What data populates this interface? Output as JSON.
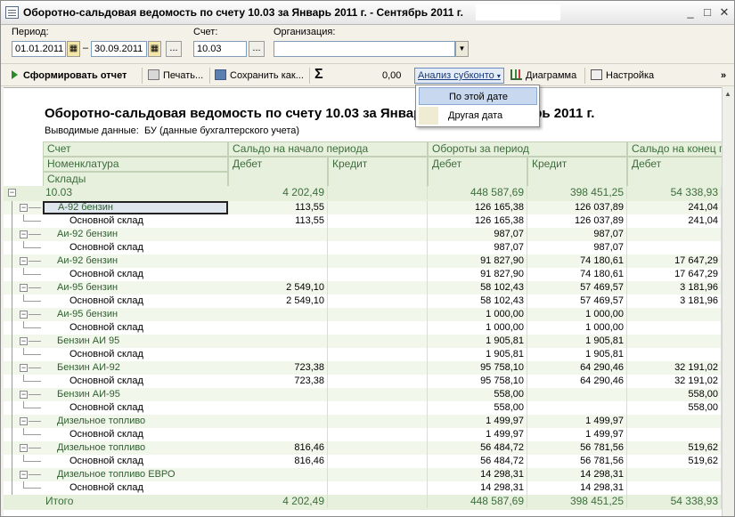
{
  "window": {
    "title": "Оборотно-сальдовая ведомость по счету 10.03 за Январь 2011 г. - Сентябрь 2011 г.",
    "btn_min": "_",
    "btn_max": "□",
    "btn_close": "✕"
  },
  "params": {
    "period_label": "Период:",
    "date_from": "01.01.2011",
    "dash": "–",
    "date_to": "30.09.2011",
    "account_label": "Счет:",
    "account": "10.03",
    "org_label": "Организация:",
    "org_value": "",
    "dots": "..."
  },
  "toolbar": {
    "generate": "Сформировать отчет",
    "print": "Печать...",
    "save": "Сохранить как...",
    "sigma": "Σ",
    "sum_value": "0,00",
    "analysis": "Анализ субконто",
    "diagram": "Диаграмма",
    "settings": "Настройка",
    "more": "»"
  },
  "dropdown": {
    "items": [
      "По этой дате",
      "Другая дата"
    ]
  },
  "report": {
    "title": "Оборотно-сальдовая ведомость по счету 10.03 за Январь 2011 г. - Сентябрь 2011 г.",
    "subtitle_label": "Выводимые данные:",
    "subtitle_value": "БУ (данные бухгалтерского учета)",
    "headers": {
      "account": "Счет",
      "nomenclature": "Номенклатура",
      "warehouses": "Склады",
      "opening": "Сальдо на начало периода",
      "turnover": "Обороты за период",
      "closing": "Сальдо на конец периода",
      "debit": "Дебет",
      "credit": "Кредит"
    },
    "total_row": {
      "name": "10.03",
      "open_d": "4 202,49",
      "turn_d": "448 587,69",
      "turn_c": "398 451,25",
      "close_d": "54 338,93"
    },
    "rows": [
      {
        "name": "А-92 бензин",
        "level": 1,
        "open_d": "113,55",
        "turn_d": "126 165,38",
        "turn_c": "126 037,89",
        "close_d": "241,04"
      },
      {
        "name": "Основной склад",
        "level": 2,
        "open_d": "113,55",
        "turn_d": "126 165,38",
        "turn_c": "126 037,89",
        "close_d": "241,04"
      },
      {
        "name": "Аи-92 бензин",
        "level": 1,
        "open_d": "",
        "turn_d": "987,07",
        "turn_c": "987,07",
        "close_d": ""
      },
      {
        "name": "Основной склад",
        "level": 2,
        "open_d": "",
        "turn_d": "987,07",
        "turn_c": "987,07",
        "close_d": ""
      },
      {
        "name": "Аи-92 бензин",
        "level": 1,
        "open_d": "",
        "turn_d": "91 827,90",
        "turn_c": "74 180,61",
        "close_d": "17 647,29"
      },
      {
        "name": "Основной склад",
        "level": 2,
        "open_d": "",
        "turn_d": "91 827,90",
        "turn_c": "74 180,61",
        "close_d": "17 647,29"
      },
      {
        "name": "Аи-95 бензин",
        "level": 1,
        "open_d": "2 549,10",
        "turn_d": "58 102,43",
        "turn_c": "57 469,57",
        "close_d": "3 181,96"
      },
      {
        "name": "Основной склад",
        "level": 2,
        "open_d": "2 549,10",
        "turn_d": "58 102,43",
        "turn_c": "57 469,57",
        "close_d": "3 181,96"
      },
      {
        "name": "Аи-95 бензин",
        "level": 1,
        "open_d": "",
        "turn_d": "1 000,00",
        "turn_c": "1 000,00",
        "close_d": ""
      },
      {
        "name": "Основной склад",
        "level": 2,
        "open_d": "",
        "turn_d": "1 000,00",
        "turn_c": "1 000,00",
        "close_d": ""
      },
      {
        "name": "Бензин АИ 95",
        "level": 1,
        "open_d": "",
        "turn_d": "1 905,81",
        "turn_c": "1 905,81",
        "close_d": ""
      },
      {
        "name": "Основной склад",
        "level": 2,
        "open_d": "",
        "turn_d": "1 905,81",
        "turn_c": "1 905,81",
        "close_d": ""
      },
      {
        "name": "Бензин АИ-92",
        "level": 1,
        "open_d": "723,38",
        "turn_d": "95 758,10",
        "turn_c": "64 290,46",
        "close_d": "32 191,02"
      },
      {
        "name": "Основной склад",
        "level": 2,
        "open_d": "723,38",
        "turn_d": "95 758,10",
        "turn_c": "64 290,46",
        "close_d": "32 191,02"
      },
      {
        "name": "Бензин АИ-95",
        "level": 1,
        "open_d": "",
        "turn_d": "558,00",
        "turn_c": "",
        "close_d": "558,00"
      },
      {
        "name": "Основной склад",
        "level": 2,
        "open_d": "",
        "turn_d": "558,00",
        "turn_c": "",
        "close_d": "558,00"
      },
      {
        "name": "Дизельное топливо",
        "level": 1,
        "open_d": "",
        "turn_d": "1 499,97",
        "turn_c": "1 499,97",
        "close_d": ""
      },
      {
        "name": "Основной склад",
        "level": 2,
        "open_d": "",
        "turn_d": "1 499,97",
        "turn_c": "1 499,97",
        "close_d": ""
      },
      {
        "name": "Дизельное топливо",
        "level": 1,
        "open_d": "816,46",
        "turn_d": "56 484,72",
        "turn_c": "56 781,56",
        "close_d": "519,62"
      },
      {
        "name": "Основной склад",
        "level": 2,
        "open_d": "816,46",
        "turn_d": "56 484,72",
        "turn_c": "56 781,56",
        "close_d": "519,62"
      },
      {
        "name": "Дизельное топливо ЕВРО",
        "level": 1,
        "open_d": "",
        "turn_d": "14 298,31",
        "turn_c": "14 298,31",
        "close_d": ""
      },
      {
        "name": "Основной склад",
        "level": 2,
        "open_d": "",
        "turn_d": "14 298,31",
        "turn_c": "14 298,31",
        "close_d": ""
      }
    ],
    "footer_row": {
      "name": "Итого",
      "open_d": "4 202,49",
      "turn_d": "448 587,69",
      "turn_c": "398 451,25",
      "close_d": "54 338,93"
    }
  },
  "colors": {
    "header_bg": "#e6f0dc",
    "header_text": "#3c6e3c",
    "group_row_bg": "#f2f7ec",
    "total_row_bg": "#e6f0dc",
    "item_text": "#2e5e2e"
  }
}
